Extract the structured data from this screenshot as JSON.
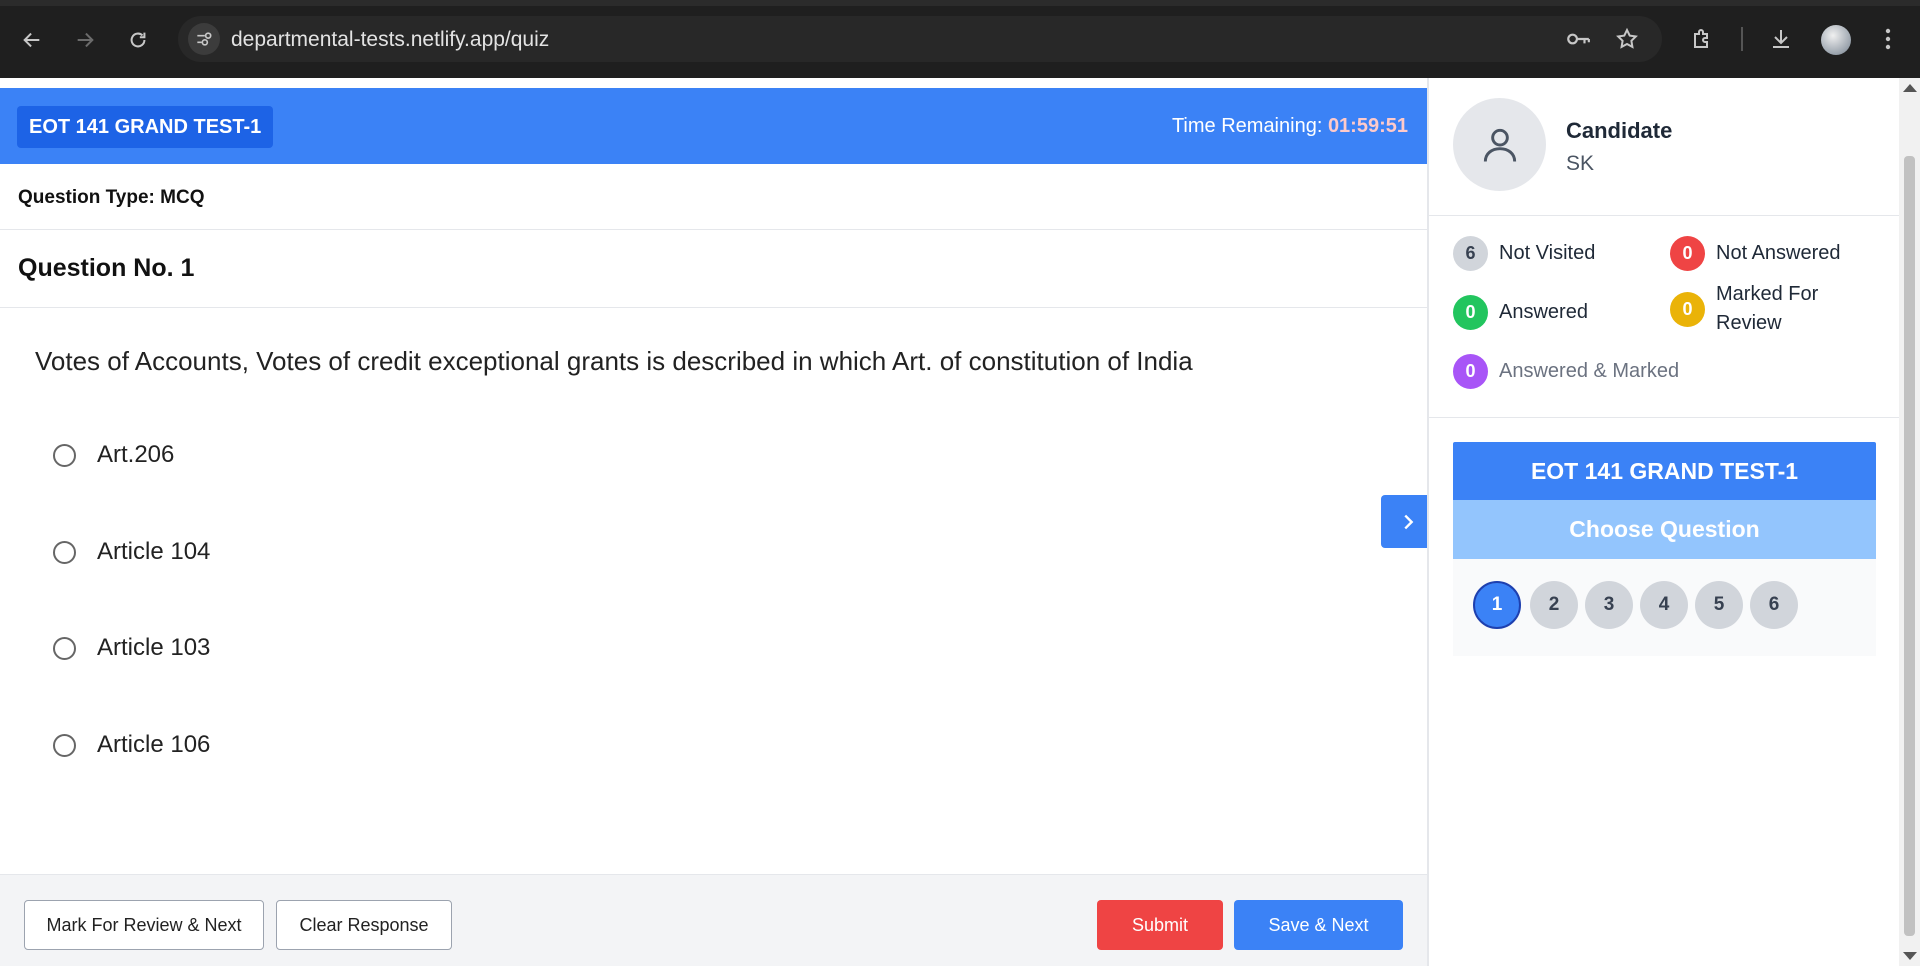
{
  "browser": {
    "url": "departmental-tests.netlify.app/quiz"
  },
  "header": {
    "test_title": "EOT 141 GRAND TEST-1",
    "timer_label": "Time Remaining: ",
    "timer_value": "01:59:51"
  },
  "question": {
    "type_label": "Question Type: MCQ",
    "number_label": "Question No. 1",
    "text": "Votes of Accounts, Votes of credit exceptional grants is described in which Art. of constitution of India",
    "options": [
      "Art.206",
      "Article 104",
      "Article 103",
      "Article 106"
    ]
  },
  "footer": {
    "mark_review": "Mark For Review & Next",
    "clear": "Clear Response",
    "submit": "Submit",
    "save_next": "Save & Next"
  },
  "sidebar": {
    "candidate_title": "Candidate",
    "candidate_name": "SK",
    "legend": [
      {
        "count": "6",
        "label": "Not Visited",
        "color": "#d1d5db"
      },
      {
        "count": "0",
        "label": "Not Answered",
        "color": "#ef4444"
      },
      {
        "count": "0",
        "label": "Answered",
        "color": "#22c55e"
      },
      {
        "count": "0",
        "label": "Marked For Review",
        "color": "#eab308"
      },
      {
        "count": "0",
        "label": "Answered & Marked",
        "color": "#a855f7"
      }
    ],
    "panel_title": "EOT 141 GRAND TEST-1",
    "panel_subtitle": "Choose Question",
    "question_numbers": [
      "1",
      "2",
      "3",
      "4",
      "5",
      "6"
    ],
    "current_question": "1"
  }
}
